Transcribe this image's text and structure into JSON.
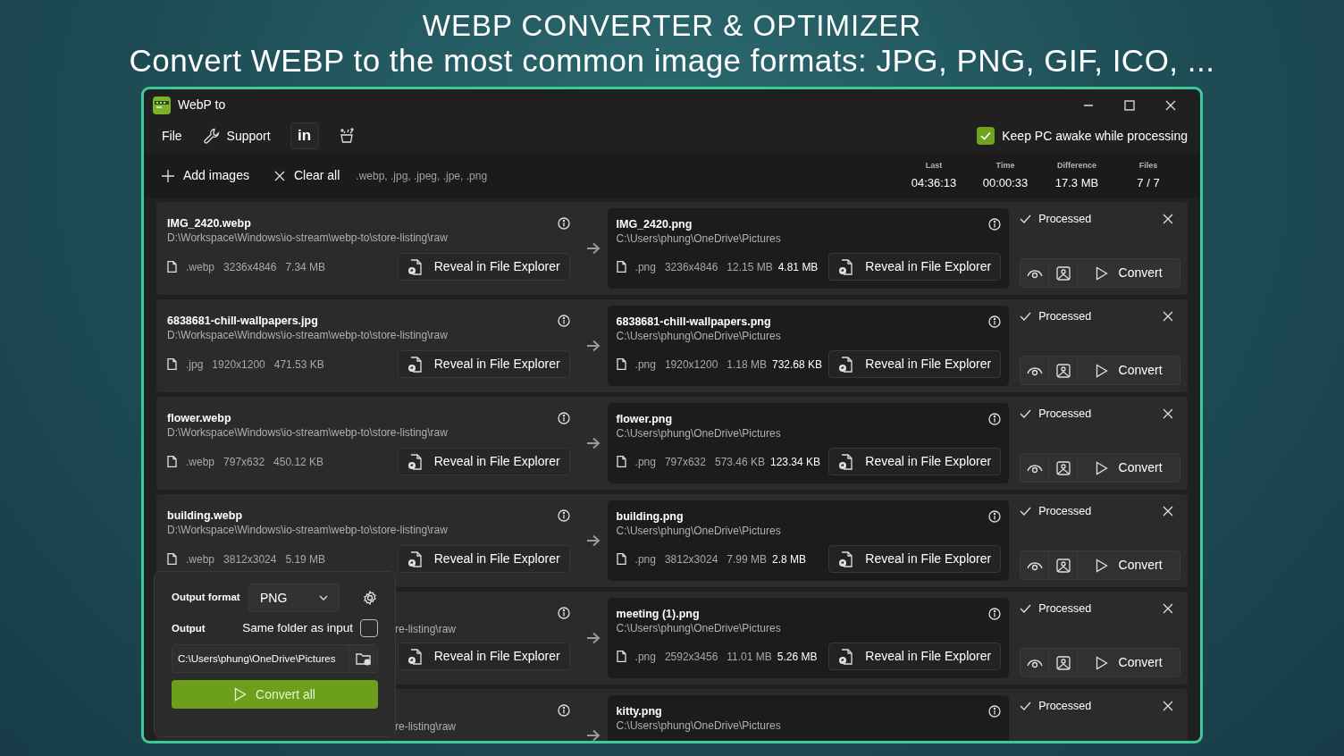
{
  "headline": {
    "title": "WEBP CONVERTER & OPTIMIZER",
    "subtitle": "Convert WEBP to the most common image formats: JPG, PNG, GIF, ICO, ..."
  },
  "window": {
    "title": "WebP to"
  },
  "menu": [
    {
      "kind": "text",
      "label": "File"
    },
    {
      "kind": "support",
      "label": "Support"
    },
    {
      "kind": "linkedin",
      "label": "in"
    },
    {
      "kind": "clean"
    }
  ],
  "keep_awake": {
    "label": "Keep PC awake while processing",
    "checked": true
  },
  "toolbar": {
    "add": "Add images",
    "clear": "Clear all",
    "extensions": ".webp, .jpg, .jpeg, .jpe, .png"
  },
  "stats": [
    {
      "label": "Last",
      "value": "04:36:13"
    },
    {
      "label": "Time",
      "value": "00:00:33"
    },
    {
      "label": "Difference",
      "value": "17.3 MB"
    },
    {
      "label": "Files",
      "value": "7 / 7"
    }
  ],
  "rows": [
    {
      "input": {
        "name": "IMG_2420.webp",
        "path": "D:\\Workspace\\Windows\\io-stream\\webp-to\\store-listing\\raw",
        "ext": ".webp",
        "dims": "3236x4846",
        "size": "7.34 MB",
        "reveal": "Reveal in File Explorer"
      },
      "output": {
        "name": "IMG_2420.png",
        "path": "C:\\Users\\phung\\OneDrive\\Pictures",
        "ext": ".png",
        "dims": "3236x4846",
        "size": "12.15 MB",
        "new_size": "4.81 MB",
        "reveal": "Reveal in File Explorer"
      },
      "status": "Processed",
      "processed": true,
      "convert": "Convert"
    },
    {
      "input": {
        "name": "6838681-chill-wallpapers.jpg",
        "path": "D:\\Workspace\\Windows\\io-stream\\webp-to\\store-listing\\raw",
        "ext": ".jpg",
        "dims": "1920x1200",
        "size": "471.53 KB",
        "reveal": "Reveal in File Explorer"
      },
      "output": {
        "name": "6838681-chill-wallpapers.png",
        "path": "C:\\Users\\phung\\OneDrive\\Pictures",
        "ext": ".png",
        "dims": "1920x1200",
        "size": "1.18 MB",
        "new_size": "732.68 KB",
        "reveal": "Reveal in File Explorer"
      },
      "status": "Processed",
      "processed": true,
      "convert": "Convert"
    },
    {
      "input": {
        "name": "flower.webp",
        "path": "D:\\Workspace\\Windows\\io-stream\\webp-to\\store-listing\\raw",
        "ext": ".webp",
        "dims": "797x632",
        "size": "450.12 KB",
        "reveal": "Reveal in File Explorer"
      },
      "output": {
        "name": "flower.png",
        "path": "C:\\Users\\phung\\OneDrive\\Pictures",
        "ext": ".png",
        "dims": "797x632",
        "size": "573.46 KB",
        "new_size": "123.34 KB",
        "reveal": "Reveal in File Explorer"
      },
      "status": "Processed",
      "processed": true,
      "convert": "Convert"
    },
    {
      "input": {
        "name": "building.webp",
        "path": "D:\\Workspace\\Windows\\io-stream\\webp-to\\store-listing\\raw",
        "ext": ".webp",
        "dims": "3812x3024",
        "size": "5.19 MB",
        "reveal": "Reveal in File Explorer"
      },
      "output": {
        "name": "building.png",
        "path": "C:\\Users\\phung\\OneDrive\\Pictures",
        "ext": ".png",
        "dims": "3812x3024",
        "size": "7.99 MB",
        "new_size": "2.8 MB",
        "reveal": "Reveal in File Explorer"
      },
      "status": "Processed",
      "processed": true,
      "convert": "Convert"
    },
    {
      "input": {
        "path": "re-listing\\raw",
        "reveal": "Reveal in File Explorer"
      },
      "output": {
        "name": "meeting (1).png",
        "path": "C:\\Users\\phung\\OneDrive\\Pictures",
        "ext": ".png",
        "dims": "2592x3456",
        "size": "11.01 MB",
        "new_size": "5.26 MB",
        "reveal": "Reveal in File Explorer"
      },
      "status": "Processed",
      "processed": true,
      "convert": "Convert"
    },
    {
      "input": {
        "path": "re-listing\\raw"
      },
      "output": {
        "name": "kitty.png",
        "path": "C:\\Users\\phung\\OneDrive\\Pictures"
      },
      "status": "Processed",
      "processed": true
    }
  ],
  "panel": {
    "format_label": "Output format",
    "format": "PNG",
    "output_label": "Output",
    "same_folder_label": "Same folder as input",
    "same_folder": false,
    "path": "C:\\Users\\phung\\OneDrive\\Pictures",
    "convert_all": "Convert all"
  }
}
